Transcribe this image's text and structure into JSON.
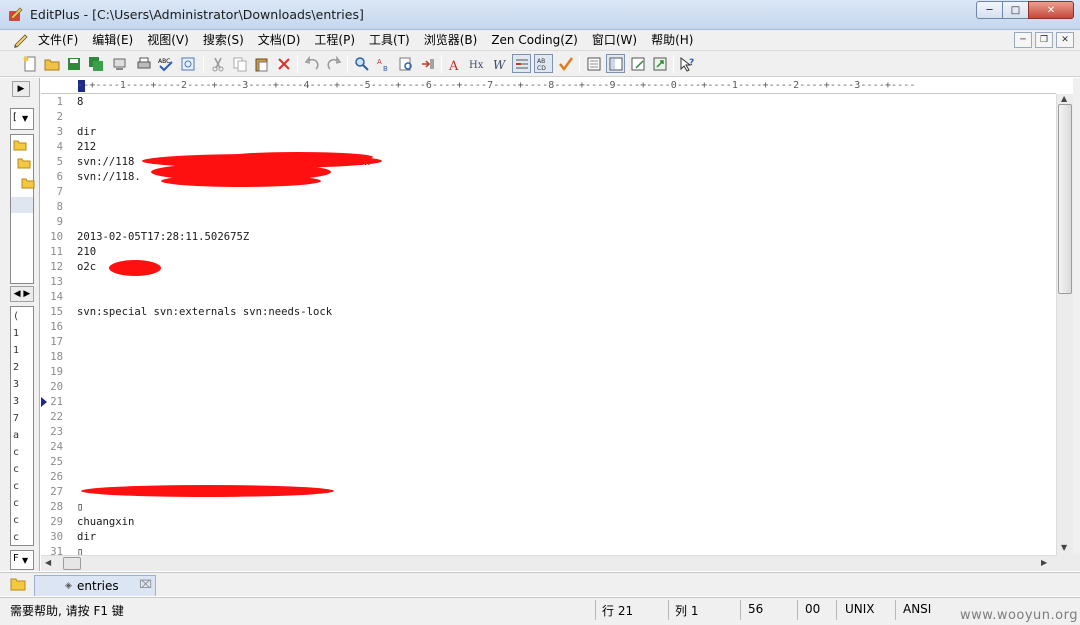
{
  "window": {
    "title": "EditPlus - [C:\\Users\\Administrator\\Downloads\\entries]"
  },
  "menu": [
    "文件(F)",
    "编辑(E)",
    "视图(V)",
    "搜索(S)",
    "文档(D)",
    "工程(P)",
    "工具(T)",
    "浏览器(B)",
    "Zen Coding(Z)",
    "窗口(W)",
    "帮助(H)"
  ],
  "ruler": "--+----1----+----2----+----3----+----4----+----5----+----6----+----7----+----8----+----9----+----0----+----1----+----2----+----3----+----",
  "lines": [
    {
      "num": "1",
      "text": "8"
    },
    {
      "num": "2",
      "text": ""
    },
    {
      "num": "3",
      "text": "dir"
    },
    {
      "num": "4",
      "text": "212"
    },
    {
      "num": "5",
      "text": "svn://118                              /www-en"
    },
    {
      "num": "6",
      "text": "svn://118."
    },
    {
      "num": "7",
      "text": ""
    },
    {
      "num": "8",
      "text": ""
    },
    {
      "num": "9",
      "text": ""
    },
    {
      "num": "10",
      "text": "2013-02-05T17:28:11.502675Z"
    },
    {
      "num": "11",
      "text": "210"
    },
    {
      "num": "12",
      "text": "o2c"
    },
    {
      "num": "13",
      "text": ""
    },
    {
      "num": "14",
      "text": ""
    },
    {
      "num": "15",
      "text": "svn:special svn:externals svn:needs-lock"
    },
    {
      "num": "16",
      "text": ""
    },
    {
      "num": "17",
      "text": ""
    },
    {
      "num": "18",
      "text": ""
    },
    {
      "num": "19",
      "text": ""
    },
    {
      "num": "20",
      "text": ""
    },
    {
      "num": "21",
      "text": ""
    },
    {
      "num": "22",
      "text": ""
    },
    {
      "num": "23",
      "text": ""
    },
    {
      "num": "24",
      "text": ""
    },
    {
      "num": "25",
      "text": ""
    },
    {
      "num": "26",
      "text": ""
    },
    {
      "num": "27",
      "text": ""
    },
    {
      "num": "28",
      "text": "▯"
    },
    {
      "num": "29",
      "text": "chuangxin"
    },
    {
      "num": "30",
      "text": "dir"
    },
    {
      "num": "31",
      "text": "▯"
    }
  ],
  "current_line": "21",
  "tab": {
    "label": "entries"
  },
  "status": {
    "help": "需要帮助, 请按 F1 键",
    "row": "行 21",
    "col": "列 1",
    "pos": "56",
    "code": "00",
    "eol": "UNIX",
    "encoding": "ANSI"
  },
  "watermark": "www.wooyun.org",
  "left_panel_chars": [
    "(",
    "1",
    "1",
    "2",
    "3",
    "3",
    "7",
    "a",
    "c",
    "c",
    "c",
    "c",
    "c",
    "c"
  ]
}
